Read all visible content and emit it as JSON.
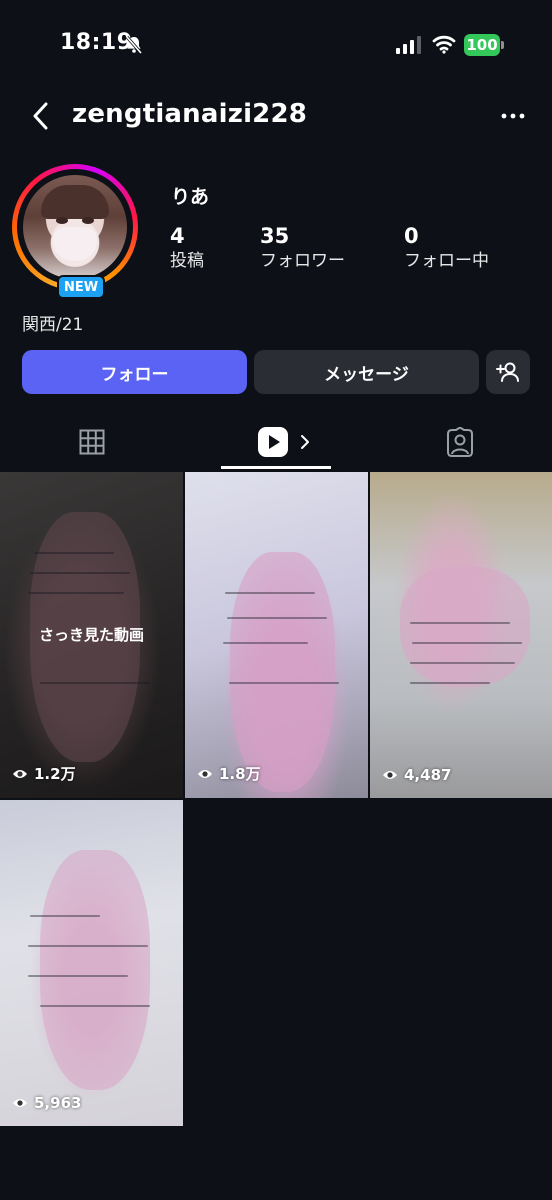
{
  "status_bar": {
    "time": "18:19",
    "battery": "100"
  },
  "header": {
    "username": "zengtianaizi228"
  },
  "profile": {
    "display_name": "りあ",
    "new_badge": "NEW",
    "bio": "関西/21",
    "stats": [
      {
        "value": "4",
        "label": "投稿"
      },
      {
        "value": "35",
        "label": "フォロワー"
      },
      {
        "value": "0",
        "label": "フォロー中"
      }
    ]
  },
  "actions": {
    "follow": "フォロー",
    "message": "メッセージ"
  },
  "tabs": {
    "active": "reels"
  },
  "videos": [
    {
      "views": "1.2万",
      "overlay": "さっき見た動画"
    },
    {
      "views": "1.8万"
    },
    {
      "views": "4,487"
    },
    {
      "views": "5,963"
    }
  ]
}
